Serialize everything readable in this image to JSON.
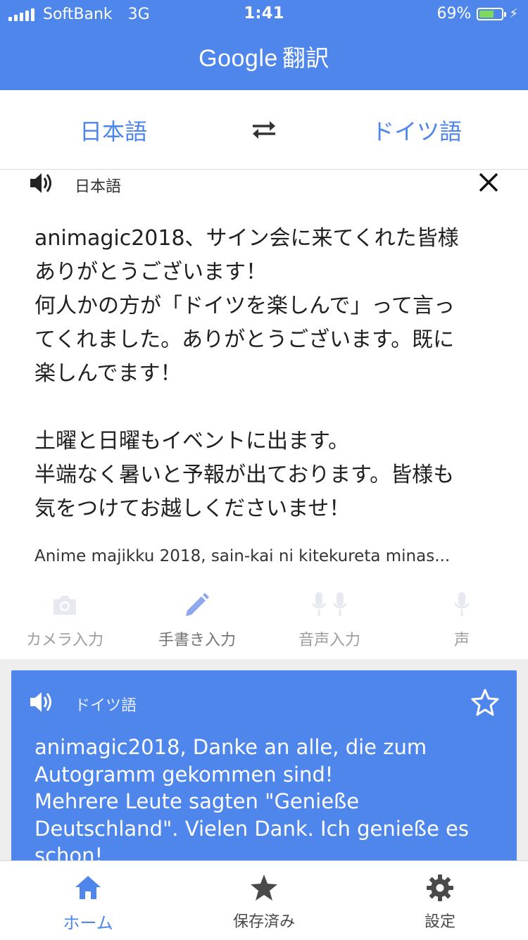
{
  "status_bar": {
    "carrier": "SoftBank",
    "network": "3G",
    "time": "1:41",
    "battery": "69%",
    "battery_level": 0.69
  },
  "app_bar": {
    "brand": "Google",
    "title": "翻訳",
    "color": "#4f86ec"
  },
  "language_bar": {
    "source": "日本語",
    "target": "ドイツ語",
    "swap_icon": "swap-arrows-icon"
  },
  "input": {
    "language_label": "日本語",
    "text": "animagic2018、サイン会に来てくれた皆様\nありがとうございます！\n何人かの方が「ドイツを楽しんで」って言っ\nてくれました。ありがとうございます。既に\n楽しんでます！\n\n土曜と日曜もイベントに出ます。\n半端なく暑いと予報が出ております。皆様も\n気をつけてお越しくださいませ！",
    "romanization": "Anime majikku 2018, sain-kai ni kitekureta minas..."
  },
  "input_tools": [
    {
      "label": "カメラ入力",
      "icon": "camera-icon"
    },
    {
      "label": "手書き入力",
      "icon": "pen-icon"
    },
    {
      "label": "音声入力",
      "icon": "dual-mic-icon"
    },
    {
      "label": "声",
      "icon": "mic-icon"
    }
  ],
  "result": {
    "language_label": "ドイツ語",
    "text": "animagic2018, Danke an alle, die zum\nAutogramm gekommen sind!\nMehrere Leute sagten \"Genieße\nDeutschland\". Vielen Dank. Ich genieße es\nschon!",
    "card_color": "#4f86ec"
  },
  "bottom_nav": {
    "home": "ホーム",
    "saved": "保存済み",
    "settings": "設定",
    "active_color": "#4f86ec"
  }
}
